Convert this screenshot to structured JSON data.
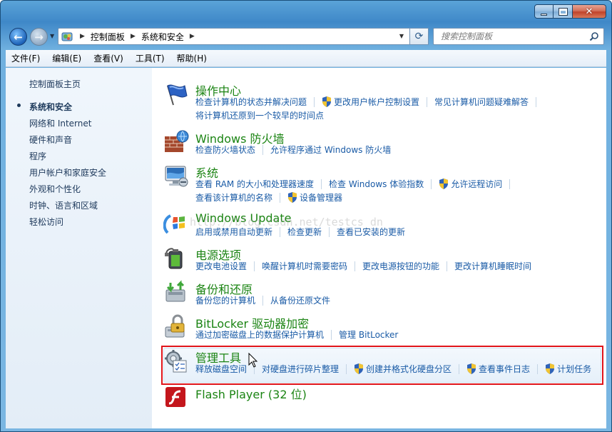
{
  "window": {
    "controls": {
      "minimize": "minimize",
      "maximize": "maximize",
      "close": "close"
    }
  },
  "address": {
    "breadcrumb": [
      "控制面板",
      "系统和安全"
    ]
  },
  "search": {
    "placeholder": "搜索控制面板"
  },
  "menu": [
    "文件(F)",
    "编辑(E)",
    "查看(V)",
    "工具(T)",
    "帮助(H)"
  ],
  "sidebar": {
    "home": "控制面板主页",
    "items": [
      "系统和安全",
      "网络和 Internet",
      "硬件和声音",
      "程序",
      "用户帐户和家庭安全",
      "外观和个性化",
      "时钟、语言和区域",
      "轻松访问"
    ],
    "active_index": 0
  },
  "categories": [
    {
      "title": "操作中心",
      "icon": "flag-icon",
      "lines": [
        [
          {
            "text": "检查计算机的状态并解决问题",
            "shield": false
          },
          {
            "text": "更改用户帐户控制设置",
            "shield": true
          },
          {
            "text": "常见计算机问题疑难解答",
            "shield": false
          }
        ],
        [
          {
            "text": "将计算机还原到一个较早的时间点",
            "shield": false
          }
        ]
      ]
    },
    {
      "title": "Windows 防火墙",
      "icon": "firewall-icon",
      "lines": [
        [
          {
            "text": "检查防火墙状态",
            "shield": false
          },
          {
            "text": "允许程序通过 Windows 防火墙",
            "shield": false
          }
        ]
      ]
    },
    {
      "title": "系统",
      "icon": "system-icon",
      "lines": [
        [
          {
            "text": "查看 RAM 的大小和处理器速度",
            "shield": false
          },
          {
            "text": "检查 Windows 体验指数",
            "shield": false
          },
          {
            "text": "允许远程访问",
            "shield": true
          }
        ],
        [
          {
            "text": "查看该计算机的名称",
            "shield": false
          },
          {
            "text": "设备管理器",
            "shield": true
          }
        ]
      ]
    },
    {
      "title": "Windows Update",
      "icon": "windows-update-icon",
      "lines": [
        [
          {
            "text": "启用或禁用自动更新",
            "shield": false
          },
          {
            "text": "检查更新",
            "shield": false
          },
          {
            "text": "查看已安装的更新",
            "shield": false
          }
        ]
      ]
    },
    {
      "title": "电源选项",
      "icon": "power-options-icon",
      "lines": [
        [
          {
            "text": "更改电池设置",
            "shield": false
          },
          {
            "text": "唤醒计算机时需要密码",
            "shield": false
          },
          {
            "text": "更改电源按钮的功能",
            "shield": false
          },
          {
            "text": "更改计算机睡眠时间",
            "shield": false
          }
        ]
      ]
    },
    {
      "title": "备份和还原",
      "icon": "backup-restore-icon",
      "lines": [
        [
          {
            "text": "备份您的计算机",
            "shield": false
          },
          {
            "text": "从备份还原文件",
            "shield": false
          }
        ]
      ]
    },
    {
      "title": "BitLocker 驱动器加密",
      "icon": "bitlocker-icon",
      "lines": [
        [
          {
            "text": "通过加密磁盘上的数据保护计算机",
            "shield": false
          },
          {
            "text": "管理 BitLocker",
            "shield": false
          }
        ]
      ]
    },
    {
      "title": "管理工具",
      "icon": "admin-tools-icon",
      "lines": [
        [
          {
            "text": "释放磁盘空间",
            "shield": false
          },
          {
            "text": "对硬盘进行碎片整理",
            "shield": false
          },
          {
            "text": "创建并格式化硬盘分区",
            "shield": true
          },
          {
            "text": "查看事件日志",
            "shield": true
          },
          {
            "text": "计划任务",
            "shield": true
          }
        ]
      ]
    },
    {
      "title": "Flash Player (32 位)",
      "icon": "flash-player-icon",
      "lines": []
    }
  ],
  "watermark": "http://blog.csdn.net/testcs_dn",
  "colors": {
    "link": "#1a5ba6",
    "category_title": "#1b8413",
    "highlight": "#e0141b"
  }
}
